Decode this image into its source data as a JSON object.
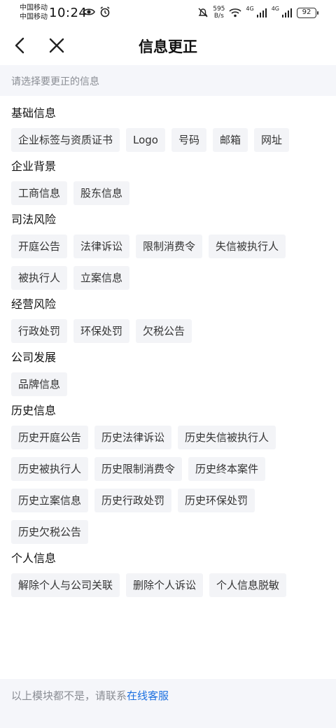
{
  "status_bar": {
    "carrier_1": "中国移动",
    "carrier_2": "中国移动",
    "time": "10:24",
    "net_speed_value": "595",
    "net_speed_unit": "B/s",
    "signal_1_label": "4G",
    "signal_2_label": "4G",
    "battery": "92",
    "icons": [
      "eye-icon",
      "alarm-icon",
      "mute-icon",
      "wifi-icon",
      "signal-icon",
      "signal-icon",
      "battery-icon"
    ]
  },
  "nav": {
    "title": "信息更正",
    "back_icon": "chevron-left-icon",
    "close_icon": "close-icon"
  },
  "hint": "请选择要更正的信息",
  "sections": [
    {
      "title": "基础信息",
      "items": [
        "企业标签与资质证书",
        "Logo",
        "号码",
        "邮箱",
        "网址"
      ]
    },
    {
      "title": "企业背景",
      "items": [
        "工商信息",
        "股东信息"
      ]
    },
    {
      "title": "司法风险",
      "items": [
        "开庭公告",
        "法律诉讼",
        "限制消费令",
        "失信被执行人",
        "被执行人",
        "立案信息"
      ]
    },
    {
      "title": "经营风险",
      "items": [
        "行政处罚",
        "环保处罚",
        "欠税公告"
      ]
    },
    {
      "title": "公司发展",
      "items": [
        "品牌信息"
      ]
    },
    {
      "title": "历史信息",
      "items": [
        "历史开庭公告",
        "历史法律诉讼",
        "历史失信被执行人",
        "历史被执行人",
        "历史限制消费令",
        "历史终本案件",
        "历史立案信息",
        "历史行政处罚",
        "历史环保处罚",
        "历史欠税公告"
      ]
    },
    {
      "title": "个人信息",
      "items": [
        "解除个人与公司关联",
        "删除个人诉讼",
        "个人信息脱敏"
      ]
    }
  ],
  "footer": {
    "text": "以上模块都不是，请联系",
    "link": "在线客服"
  },
  "colors": {
    "link": "#1a6fe0",
    "chip_bg": "#f3f4f7",
    "hint_bg": "#f5f6fa"
  }
}
